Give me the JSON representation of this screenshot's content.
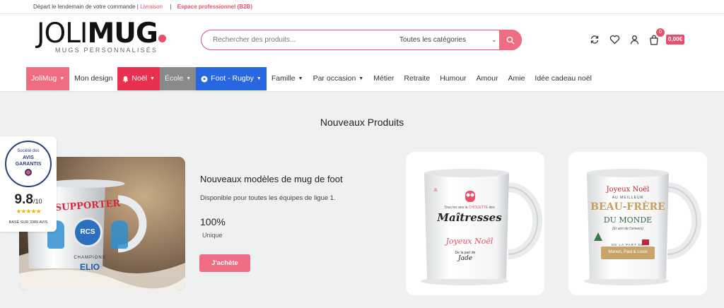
{
  "topbar": {
    "text": "Départ le lendemain de votre commande |",
    "link": "Livraison",
    "sep": "|",
    "b2b": "Espace professionnel (B2B)"
  },
  "logo": {
    "main_light": "JOLI",
    "main_bold": "MUG",
    "sub": "MUGS PERSONNALISÉS"
  },
  "search": {
    "placeholder": "Rechercher des produits...",
    "category": "Toutes les catégories"
  },
  "cart": {
    "count": "0",
    "total": "0,00€"
  },
  "nav": [
    {
      "label": "JoliMug",
      "chevron": true,
      "style": "pink"
    },
    {
      "label": "Mon design",
      "chevron": false,
      "style": ""
    },
    {
      "label": "Noël",
      "chevron": true,
      "style": "red",
      "icon": "bell-icon"
    },
    {
      "label": "École",
      "chevron": true,
      "style": "grey"
    },
    {
      "label": "Foot - Rugby",
      "chevron": true,
      "style": "blue",
      "icon": "ball-icon"
    },
    {
      "label": "Famille",
      "chevron": true,
      "style": ""
    },
    {
      "label": "Par occasion",
      "chevron": true,
      "style": ""
    },
    {
      "label": "Métier",
      "chevron": false,
      "style": ""
    },
    {
      "label": "Retraite",
      "chevron": false,
      "style": ""
    },
    {
      "label": "Humour",
      "chevron": false,
      "style": ""
    },
    {
      "label": "Amour",
      "chevron": false,
      "style": ""
    },
    {
      "label": "Amie",
      "chevron": false,
      "style": ""
    },
    {
      "label": "Idée cadeau noël",
      "chevron": false,
      "style": ""
    }
  ],
  "section_title": "Nouveaux Produits",
  "avis": {
    "line1": "Société des",
    "line2": "AVIS",
    "line3": "GARANTIS",
    "score": "9.8",
    "out_of": "/10",
    "stars": "★★★★★",
    "base": "BASÉ SUR 3389 AVIS"
  },
  "hero_mug": {
    "banner": "SUPPORTER",
    "club": "RCS",
    "bottom": "CHAMPIONS",
    "name": "ELIO"
  },
  "product": {
    "title": "Nouveaux modèles de mug de foot",
    "description": "Disponible pour toutes les équipes de ligue 1.",
    "percent": "100%",
    "unit": "Unique",
    "buy_label": "J'achète"
  },
  "mug1": {
    "line1": "Tous les ans la",
    "owl_word": "CHOUETTE",
    "line2": "des",
    "big": "Maîtresses",
    "wish": "Joyeux Noël",
    "sign1": "De la part de",
    "sign2": "Jade"
  },
  "mug2": {
    "top": "Joyeux Noël",
    "sub": "AU MEILLEUR",
    "big": "BEAU-FRÈRE",
    "mid": "DU MONDE",
    "small": "(Et ami de l'univers)",
    "from": "DE LA PART DE",
    "names": "Manon, Paul & Louis"
  },
  "colors": {
    "accent": "#ee6d82",
    "noel": "#e83050",
    "ecole": "#8a8a8a",
    "foot": "#2767e0"
  }
}
